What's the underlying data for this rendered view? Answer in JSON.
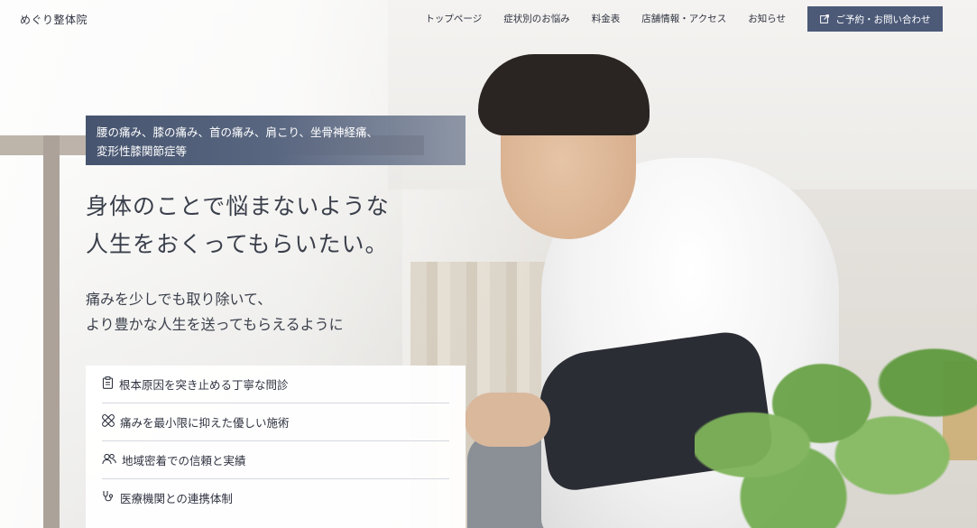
{
  "header": {
    "logo": "めぐり整体院",
    "nav": [
      {
        "label": "トップページ"
      },
      {
        "label": "症状別のお悩み"
      },
      {
        "label": "料金表"
      },
      {
        "label": "店舗情報・アクセス"
      },
      {
        "label": "お知らせ"
      }
    ],
    "cta": {
      "label": "ご予約・お問い合わせ",
      "icon": "external-link-icon",
      "color": "#4c5a78"
    }
  },
  "hero": {
    "symptoms_line1": "腰の痛み、膝の痛み、首の痛み、肩こり、坐骨神経痛、",
    "symptoms_line2": "変形性膝関節症等",
    "headline_line1": "身体のことで悩まないような",
    "headline_line2": "人生をおくってもらいたい。",
    "subline_line1": "痛みを少しでも取り除いて、",
    "subline_line2": "より豊かな人生を送ってもらえるように"
  },
  "features": [
    {
      "icon": "clipboard-icon",
      "label": "根本原因を突き止める丁寧な問診"
    },
    {
      "icon": "bandage-icon",
      "label": "痛みを最小限に抑えた優しい施術"
    },
    {
      "icon": "people-icon",
      "label": "地域密着での信頼と実績"
    },
    {
      "icon": "stethoscope-icon",
      "label": "医療機関との連携体制"
    }
  ],
  "colors": {
    "accent": "#4c5a78",
    "text": "#2f3340"
  }
}
